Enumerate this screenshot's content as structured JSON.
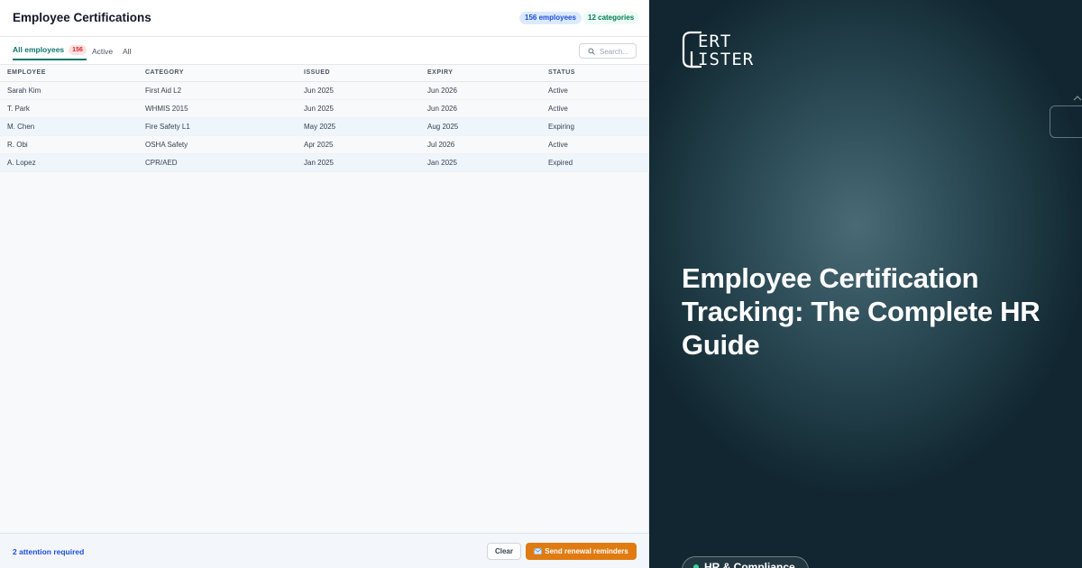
{
  "app": {
    "title": "Employee Certifications",
    "employees_pill": "156 employees",
    "categories_pill": "12 categories",
    "tabs": [
      {
        "label": "All employees",
        "count": "156",
        "active": true
      },
      {
        "label": "Active",
        "active": false
      },
      {
        "label": "All",
        "active": false
      }
    ],
    "search": {
      "placeholder": "Search..."
    },
    "table": {
      "columns": [
        "EMPLOYEE",
        "CATEGORY",
        "ISSUED",
        "EXPIRY",
        "STATUS"
      ],
      "rows": [
        [
          "Sarah Kim",
          "First Aid L2",
          "Jun 2025",
          "Jun 2026",
          "Active"
        ],
        [
          "T. Park",
          "WHMIS 2015",
          "Jun 2025",
          "Jun 2026",
          "Active"
        ],
        [
          "M. Chen",
          "Fire Safety L1",
          "May 2025",
          "Aug 2025",
          "Expiring"
        ],
        [
          "R. Obi",
          "OSHA Safety",
          "Apr 2025",
          "Jul 2026",
          "Active"
        ],
        [
          "A. Lopez",
          "CPR/AED",
          "Jan 2025",
          "Jan 2025",
          "Expired"
        ]
      ]
    },
    "footer": {
      "attention": "2 attention required",
      "clear_label": "Clear",
      "send_label": "Send renewal reminders",
      "send_icon": "envelope-icon"
    },
    "colors": {
      "accent": "#0f766e",
      "primary_action": "#e07b12",
      "badge_red": "#dc2626"
    }
  },
  "promo": {
    "logo_text": "CERT LISTER",
    "headline": "Employee Certification Tracking: The Complete HR Guide",
    "tag": "HR & Compliance",
    "background": "#1d3842"
  }
}
